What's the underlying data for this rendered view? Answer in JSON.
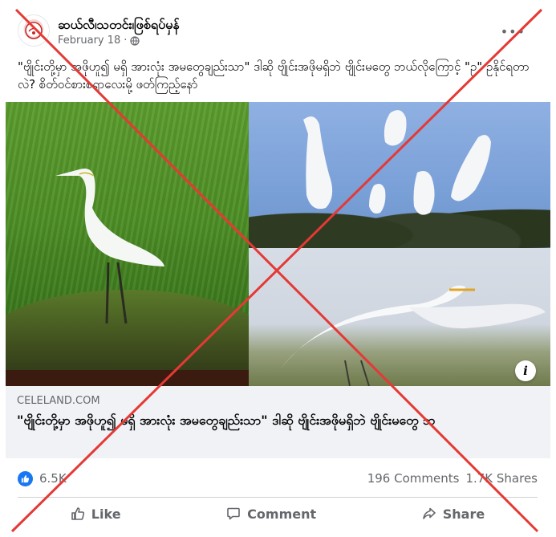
{
  "post": {
    "page_name": "ဆယ်လီ၊သတင်း၊ဖြစ်ရပ်မှန်",
    "date": "February 18",
    "text": "\"ဗျိုင်းတို့မှာ အဖိုဟူ၍ မရှိ အားလုံး အမတွေချည်းသာ\" ဒါဆို ဗျိုင်းအဖိုမရှိဘဲ ဗျိုင်းမတွေ ဘယ်လိုကြောင့် \"ဥ\" ဥနိုင်ရတာလဲ? စိတ်ဝင်စားစရာလေးမို့ ဖတ်ကြည့်နော်"
  },
  "link": {
    "domain": "CELELAND.COM",
    "title": "\"ဗျိုင်းတို့မှာ အဖိုဟူ၍ မရှိ အားလုံး အမတွေချည်းသာ\" ဒါဆို ဗျိုင်းအဖိုမရှိဘဲ ဗျိုင်းမတွေ ဘ"
  },
  "stats": {
    "reactions": "6.5K",
    "comments": "196 Comments",
    "shares": "1.7K Shares"
  },
  "actions": {
    "like": "Like",
    "comment": "Comment",
    "share": "Share"
  },
  "icons": {
    "globe": "globe-icon",
    "more": "more-options-icon",
    "info": "info-icon",
    "like_reaction": "like-reaction-icon",
    "thumb": "thumbs-up-icon",
    "comment": "comment-icon",
    "share": "share-icon"
  },
  "colors": {
    "overlay_x": "#e53935",
    "like_blue": "#1877f2",
    "link_bg": "#f0f2f5"
  }
}
